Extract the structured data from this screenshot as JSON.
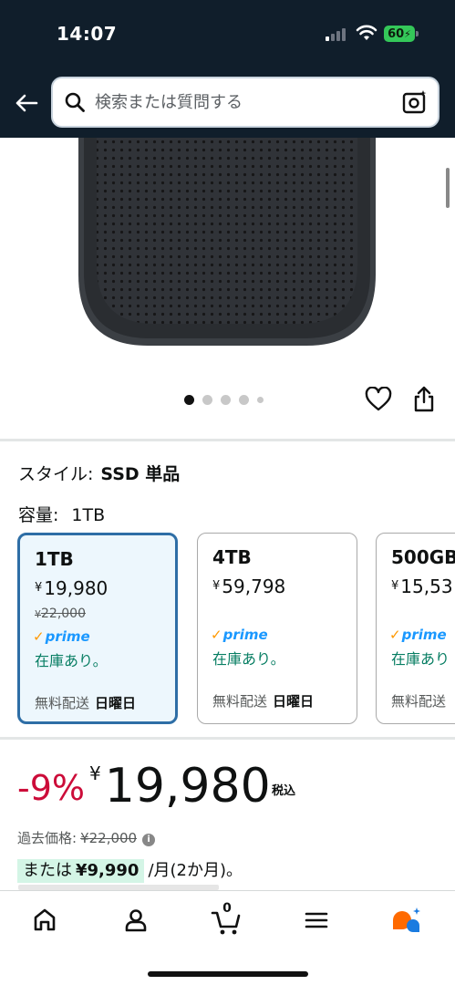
{
  "status_bar": {
    "time": "14:07",
    "battery": "60"
  },
  "search": {
    "placeholder": "検索または質問する"
  },
  "product_gallery": {
    "dot_count": 5,
    "active_dot": 1
  },
  "variants": {
    "style_label": "スタイル:",
    "style_value": "SSD 単品",
    "capacity_label": "容量:",
    "capacity_value": "1TB",
    "options": [
      {
        "capacity": "1TB",
        "price": "19,980",
        "old_price": "22,000",
        "prime": "prime",
        "stock": "在庫あり。",
        "shipping": "無料配送",
        "delivery_day": "日曜日",
        "selected": true
      },
      {
        "capacity": "4TB",
        "price": "59,798",
        "prime": "prime",
        "stock": "在庫あり。",
        "shipping": "無料配送",
        "delivery_day": "日曜日",
        "selected": false
      },
      {
        "capacity": "500GB",
        "price": "15,53",
        "prime": "prime",
        "stock": "在庫あり",
        "shipping": "無料配送",
        "selected": false
      }
    ]
  },
  "price_block": {
    "discount": "-9%",
    "currency": "¥",
    "price": "19,980",
    "tax_label": "税込",
    "past_label": "過去価格:",
    "past_price": "¥22,000",
    "installment_prefix": "または",
    "installment_price": "¥9,990",
    "installment_suffix": "/月(2か月)。"
  },
  "bottom_nav": {
    "cart_count": "0",
    "items": [
      "home-icon",
      "account-icon",
      "cart-icon",
      "menu-icon",
      "rufus-icon"
    ]
  },
  "colors": {
    "header_bg": "#101e2b",
    "selected_border": "#2e6ea6",
    "selected_bg": "#edf7fd",
    "discount_red": "#cc0c39",
    "stock_green": "#067d62",
    "prime_blue": "#1a98ff",
    "install_bg": "#d4f5e6"
  }
}
